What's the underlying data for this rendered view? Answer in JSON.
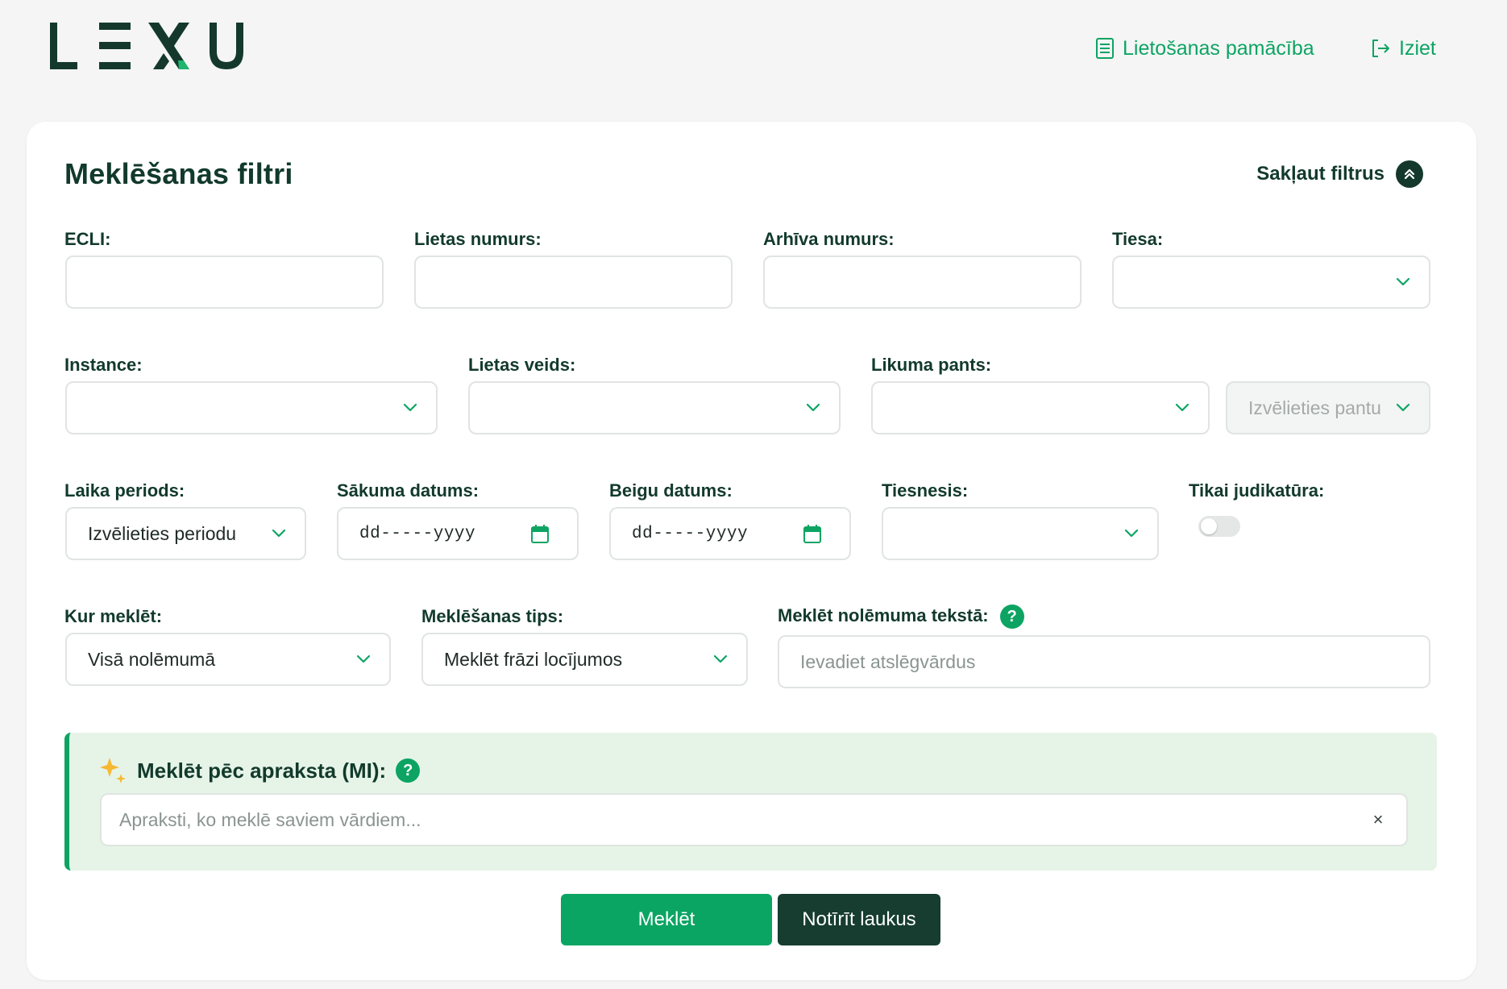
{
  "header": {
    "logo_text": "LEXU",
    "guide_label": "Lietošanas pamācība",
    "logout_label": "Iziet"
  },
  "filters": {
    "title": "Meklēšanas filtri",
    "collapse_label": "Sakļaut filtrus",
    "ecli": {
      "label": "ECLI:",
      "value": ""
    },
    "case_number": {
      "label": "Lietas numurs:",
      "value": ""
    },
    "archive_number": {
      "label": "Arhīva numurs:",
      "value": ""
    },
    "court": {
      "label": "Tiesa:",
      "value": ""
    },
    "instance": {
      "label": "Instance:",
      "value": ""
    },
    "case_type": {
      "label": "Lietas veids:",
      "value": ""
    },
    "law_article": {
      "label": "Likuma pants:",
      "value": "",
      "article_placeholder": "Izvēlieties pantu"
    },
    "time_period": {
      "label": "Laika periods:",
      "value": "Izvēlieties periodu"
    },
    "start_date": {
      "label": "Sākuma datums:",
      "placeholder": "dd-----yyyy"
    },
    "end_date": {
      "label": "Beigu datums:",
      "placeholder": "dd-----yyyy"
    },
    "judge": {
      "label": "Tiesnesis:",
      "value": ""
    },
    "judicature_only": {
      "label": "Tikai judikatūra:",
      "checked": false
    },
    "where_search": {
      "label": "Kur meklēt:",
      "value": "Visā nolēmumā"
    },
    "search_type": {
      "label": "Meklēšanas tips:",
      "value": "Meklēt frāzi locījumos"
    },
    "text_search": {
      "label": "Meklēt nolēmuma tekstā:",
      "placeholder": "Ievadiet atslēgvārdus",
      "help": "?"
    }
  },
  "ai_search": {
    "label": "Meklēt pēc apraksta (MI):",
    "help": "?",
    "placeholder": "Apraksti, ko meklē saviem vārdiem...",
    "clear_glyph": "×"
  },
  "actions": {
    "search_label": "Meklēt",
    "clear_label": "Notīrīt laukus"
  },
  "colors": {
    "brand_dark": "#14392c",
    "brand_green": "#0da463",
    "ai_panel_bg": "#e6f4e8",
    "page_bg": "#f5f5f5"
  }
}
